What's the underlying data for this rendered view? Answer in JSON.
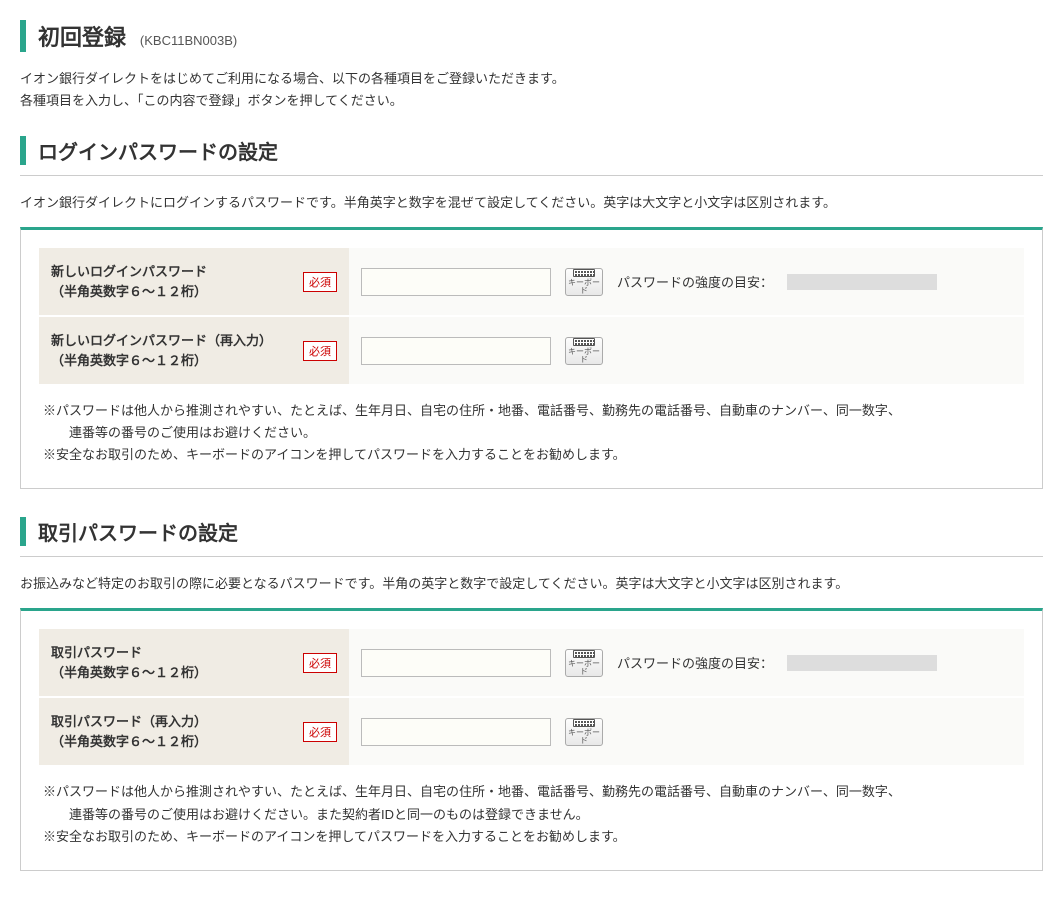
{
  "page": {
    "title": "初回登録",
    "code": "(KBC11BN003B)",
    "intro_line1": "イオン銀行ダイレクトをはじめてご利用になる場合、以下の各種項目をご登録いただきます。",
    "intro_line2": "各種項目を入力し、「この内容で登録」ボタンを押してください。"
  },
  "common": {
    "required_label": "必須",
    "keyboard_label": "キーボード",
    "strength_label": "パスワードの強度の目安："
  },
  "login_password": {
    "heading": "ログインパスワードの設定",
    "description": "イオン銀行ダイレクトにログインするパスワードです。半角英字と数字を混ぜて設定してください。英字は大文字と小文字は区別されます。",
    "row1": {
      "label_line1": "新しいログインパスワード",
      "label_line2": "（半角英数字６～１２桁）"
    },
    "row2": {
      "label_line1": "新しいログインパスワード（再入力）",
      "label_line2": "（半角英数字６～１２桁）"
    },
    "note_line1": "※パスワードは他人から推測されやすい、たとえば、生年月日、自宅の住所・地番、電話番号、勤務先の電話番号、自動車のナンバー、同一数字、",
    "note_line1b": "連番等の番号のご使用はお避けください。",
    "note_line2": "※安全なお取引のため、キーボードのアイコンを押してパスワードを入力することをお勧めします。"
  },
  "transaction_password": {
    "heading": "取引パスワードの設定",
    "description": "お振込みなど特定のお取引の際に必要となるパスワードです。半角の英字と数字で設定してください。英字は大文字と小文字は区別されます。",
    "row1": {
      "label_line1": "取引パスワード",
      "label_line2": "（半角英数字６～１２桁）"
    },
    "row2": {
      "label_line1": "取引パスワード（再入力）",
      "label_line2": "（半角英数字６～１２桁）"
    },
    "note_line1": "※パスワードは他人から推測されやすい、たとえば、生年月日、自宅の住所・地番、電話番号、勤務先の電話番号、自動車のナンバー、同一数字、",
    "note_line1b": "連番等の番号のご使用はお避けください。また契約者IDと同一のものは登録できません。",
    "note_line2": "※安全なお取引のため、キーボードのアイコンを押してパスワードを入力することをお勧めします。"
  }
}
